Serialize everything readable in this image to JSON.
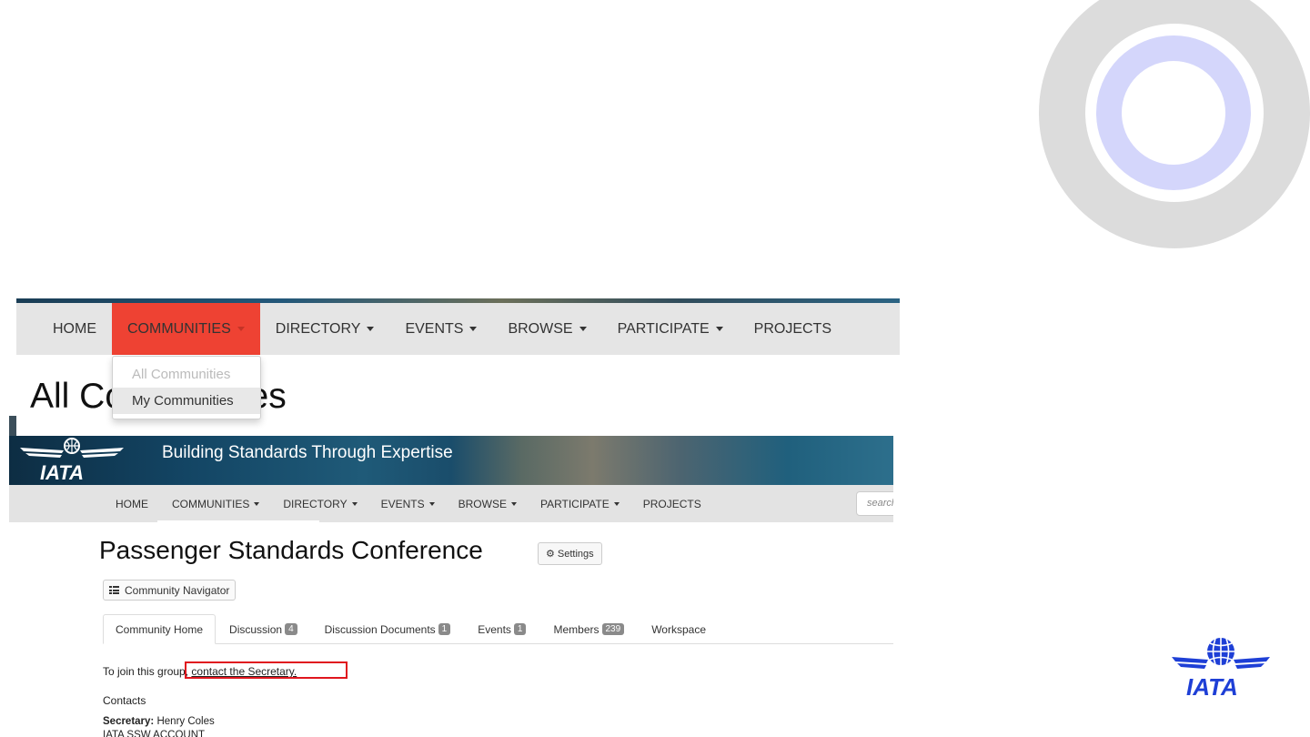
{
  "colors": {
    "accent_red": "#ee4233",
    "ring_gray": "#dcdcdc",
    "ring_blue": "#d4d6fb",
    "iata_blue": "#1e3fd6",
    "highlight_red": "#e0161e"
  },
  "screenshot1": {
    "nav": {
      "home": "HOME",
      "communities": "COMMUNITIES",
      "directory": "DIRECTORY",
      "events": "EVENTS",
      "browse": "BROWSE",
      "participate": "PARTICIPATE",
      "projects": "PROJECTS"
    },
    "dropdown": {
      "all": "All Communities",
      "mine": "My Communities"
    },
    "heading": "All Communities"
  },
  "screenshot2": {
    "logo_text": "IATA",
    "banner_title": "Building Standards Through Expertise",
    "nav": {
      "home": "HOME",
      "communities": "COMMUNITIES",
      "directory": "DIRECTORY",
      "events": "EVENTS",
      "browse": "BROWSE",
      "participate": "PARTICIPATE",
      "projects": "PROJECTS"
    },
    "search_placeholder": "search",
    "page_title": "Passenger Standards Conference",
    "settings_label": "Settings",
    "community_navigator_label": "Community Navigator",
    "tabs": [
      {
        "label": "Community Home",
        "badge": ""
      },
      {
        "label": "Discussion",
        "badge": "4"
      },
      {
        "label": "Discussion Documents",
        "badge": "1"
      },
      {
        "label": "Events",
        "badge": "1"
      },
      {
        "label": "Members",
        "badge": "239"
      },
      {
        "label": "Workspace",
        "badge": ""
      }
    ],
    "join_prefix": "To join this group,",
    "join_link": "contact the Secretary.",
    "contacts_label": "Contacts",
    "secretary_label": "Secretary:",
    "secretary_name": "Henry Coles",
    "account_line": "IATA SSW ACCOUNT"
  },
  "corner_logo_text": "IATA"
}
